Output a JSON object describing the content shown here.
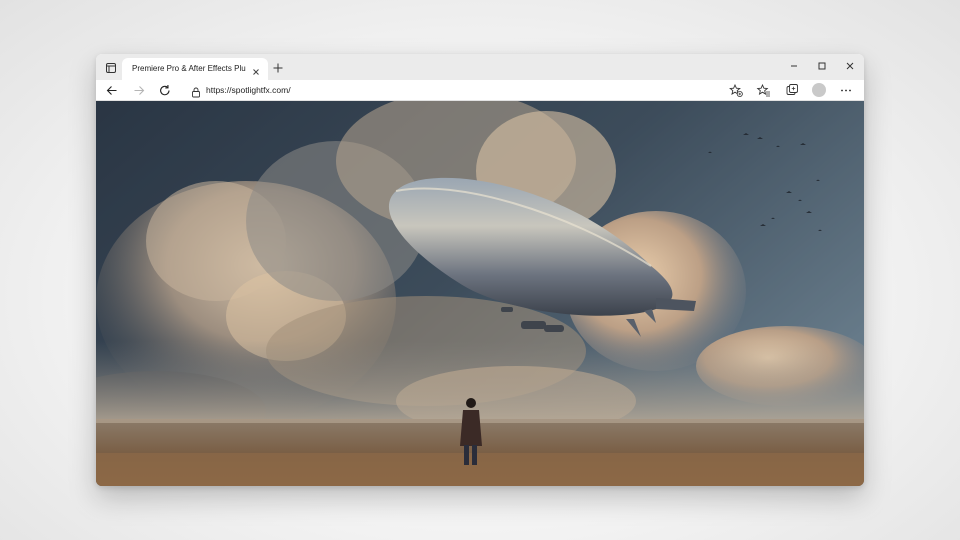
{
  "browser": {
    "tab": {
      "title": "Premiere Pro & After Effects Plugin..."
    },
    "address_bar": {
      "url": "https://spotlightfx.com/"
    },
    "icons": {
      "tab_actions": "tab-actions-icon",
      "tab_close": "close-icon",
      "new_tab": "plus-icon",
      "minimize": "minimize-icon",
      "maximize": "maximize-icon",
      "close": "close-icon",
      "back": "arrow-left-icon",
      "forward": "arrow-right-icon",
      "refresh": "refresh-icon",
      "lock": "lock-icon",
      "add_favorite": "star-plus-icon",
      "favorites": "star-list-icon",
      "collections": "collections-icon",
      "profile": "avatar",
      "menu": "more-icon"
    }
  },
  "page": {
    "hero_image": "airship-over-field-illustration"
  },
  "colors": {
    "titlebar": "#ebebeb",
    "toolbar": "#ffffff",
    "sky_top": "#2e3e52",
    "cloud_highlight": "#e8c9a4",
    "field": "#8a6a4c"
  }
}
